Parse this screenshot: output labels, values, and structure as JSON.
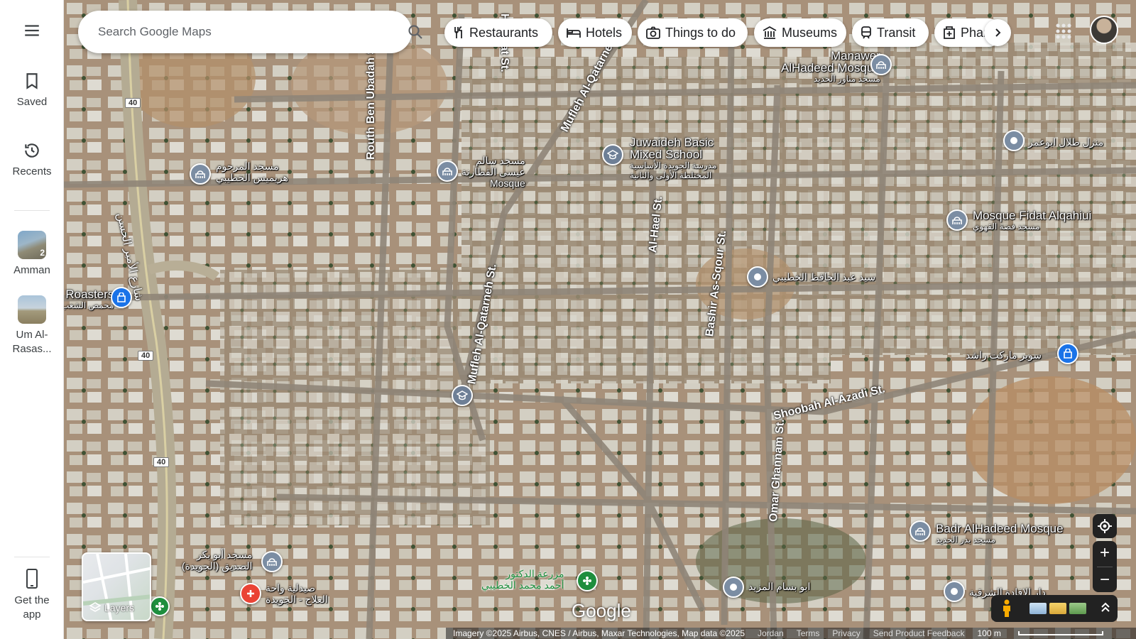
{
  "search": {
    "placeholder": "Search Google Maps"
  },
  "rail": {
    "saved": "Saved",
    "recents": "Recents",
    "places": [
      {
        "label": "Amman",
        "count": "2"
      },
      {
        "label": "Um Al-\nRasas..."
      }
    ],
    "get_app": "Get the\napp"
  },
  "chips": [
    "Restaurants",
    "Hotels",
    "Things to do",
    "Museums",
    "Transit",
    "Pharmacies"
  ],
  "streets": [
    "Mufleh Al-Qatarneh St.",
    "Routh Ben Ubadah St.",
    "Al-Hael St.",
    "Bashir As-Sqour St.",
    "Mufleh Al-Qatarneh St.",
    "Shoobah Al-Azadi St.",
    "Omar Ghannam St.",
    "Halimat St."
  ],
  "highway": {
    "number": "40",
    "arabic_name": "شارع الأمير الحسن"
  },
  "pois": {
    "manawer_mosque": {
      "name": "Manawer\nAlHadeed Mosque",
      "arabic": "مسجد مناور الحديد"
    },
    "juwaideh_school": {
      "name": "Juwaideh Basic\nMixed School",
      "arabic": "مدرسة الجويدة الأساسية\nالمختلطة الأولى والثانية"
    },
    "salem_mosque": {
      "arabic": "مسجد سالم\nعيسى القطارنة",
      "name": "Mosque"
    },
    "harimis_mosque": {
      "arabic": "مسجد المرحوم\nهريميس الخطيبي"
    },
    "talal_house": {
      "arabic": "منزل طلال ابوعمر"
    },
    "fidat_mosque": {
      "name": "Mosque Fidat Alqahiui",
      "arabic": "مسجد فضة القهوي"
    },
    "abd_hafez": {
      "arabic": "سيد عبد الحافظ الخطيبي"
    },
    "roasters": {
      "name": "Roasters",
      "arabic": "محمص الشعب"
    },
    "rashed_market": {
      "arabic": "سوبر ماركت راشد"
    },
    "badr_mosque": {
      "name": "Badr AlHadeed Mosque",
      "arabic": "مسجد بدر الحديد"
    },
    "abu_bakr_mosque": {
      "arabic": "مسجد أبو بكر\nالصديق (الجويدة)"
    },
    "oasis_pharmacy": {
      "arabic": "صيدلية واحة\nالعلاج - الجويدة"
    },
    "farm": {
      "arabic": "مزرعة الدكتور\nأحمد محمد الخطيبي"
    },
    "abu_bassam": {
      "arabic": "ابو بسام المزيد"
    },
    "sharqiya": {
      "arabic": "دار الإفادة الشرقية"
    }
  },
  "controls": {
    "layers": "Layers",
    "zoom_in": "+",
    "zoom_out": "−"
  },
  "logo": "Google",
  "attribution": {
    "imagery": "Imagery ©2025 Airbus, CNES / Airbus, Maxar Technologies, Map data ©2025",
    "region": "Jordan",
    "terms": "Terms",
    "privacy": "Privacy",
    "feedback": "Send Product Feedback",
    "scale": "100 m"
  }
}
